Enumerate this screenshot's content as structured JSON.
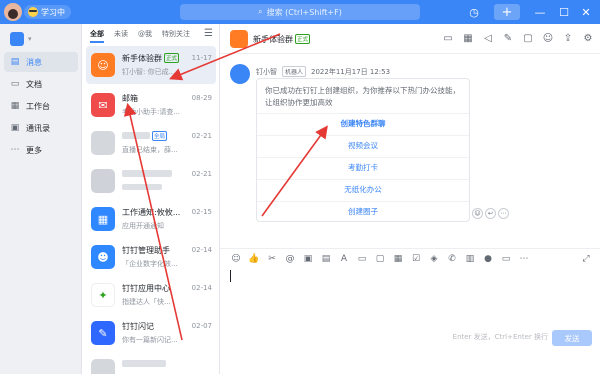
{
  "titlebar": {
    "status": "学习中",
    "search_placeholder": "搜索 (Ctrl+Shift+F)",
    "icons": [
      "history-icon",
      "plus-icon",
      "minimize-icon",
      "maximize-icon",
      "close-icon"
    ]
  },
  "nav": {
    "items": [
      {
        "label": "消息",
        "icon": "message-icon",
        "active": true
      },
      {
        "label": "文档",
        "icon": "doc-icon",
        "active": false
      },
      {
        "label": "工作台",
        "icon": "workbench-icon",
        "active": false
      },
      {
        "label": "通讯录",
        "icon": "contacts-icon",
        "active": false
      },
      {
        "label": "更多",
        "icon": "more-icon",
        "active": false
      }
    ]
  },
  "tabs": [
    "全部",
    "未读",
    "@我",
    "特别关注"
  ],
  "conversations": [
    {
      "name": "新手体验群",
      "tag": "正式",
      "message": "钉小智: 你已成...",
      "time": "11-17",
      "color": "#ff7c25",
      "selected": true
    },
    {
      "name": "邮箱",
      "message": "考勤小助手:请查...",
      "time": "08-29",
      "color": "#f04b4b"
    },
    {
      "name": "",
      "tag": "全局",
      "message": "直播已结束，薛...",
      "time": "02-21",
      "color": "#d4d7dc"
    },
    {
      "name": "",
      "message": "",
      "time": "02-21",
      "color": "#d4d7dc"
    },
    {
      "name": "工作通知:攸攸...",
      "message": "应用开通通知",
      "time": "02-15",
      "color": "#2f88ff"
    },
    {
      "name": "钉钉管理助手",
      "message": "「企业数字化效...",
      "time": "02-14",
      "color": "#2f88ff"
    },
    {
      "name": "钉钉应用中心",
      "message": "指建达人「快...",
      "time": "02-14",
      "color": "#ffffff"
    },
    {
      "name": "钉钉闪记",
      "message": "你有一篇新闪记...",
      "time": "02-07",
      "color": "#2f68ff"
    },
    {
      "name": "",
      "message": "",
      "time": "",
      "color": "#d4d7dc"
    }
  ],
  "chat": {
    "title": "新手体验群",
    "title_tag": "正式",
    "sender": "钉小智",
    "sender_tag": "机器人",
    "timestamp": "2022年11月17日 12:53",
    "card_text": "你已成功在钉钉上创建组织，为你推荐以下热门办公技能，让组织协作更加高效",
    "links": [
      "创建特色群聊",
      "视频会议",
      "考勤打卡",
      "无纸化办公",
      "创建圈子"
    ],
    "send_hint": "Enter 发送，Ctrl+Enter 换行",
    "send_label": "发送"
  }
}
